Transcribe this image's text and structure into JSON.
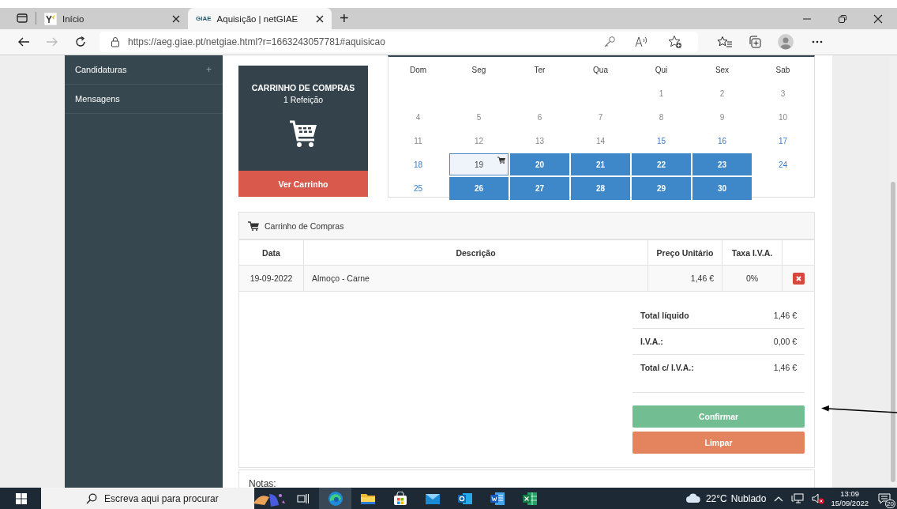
{
  "browser": {
    "tabs": [
      {
        "title": "Início",
        "selected": false,
        "favicon": {
          "kind": "image"
        }
      },
      {
        "title": "Aquisição | netGIAE",
        "selected": true,
        "favicon": {
          "kind": "text",
          "text": "GIAE"
        }
      }
    ],
    "new_tab": "+",
    "url": "https://aeg.giae.pt/netgiae.html?r=1663243057781#aquisicao"
  },
  "sidebar": {
    "items": [
      {
        "label": "Candidaturas",
        "expander": "+"
      },
      {
        "label": "Mensagens"
      }
    ]
  },
  "cart_card": {
    "title": "CARRINHO DE COMPRAS",
    "count": "1 Refeição",
    "button": "Ver Carrinho"
  },
  "calendar": {
    "weekdays": [
      "Dom",
      "Seg",
      "Ter",
      "Qua",
      "Qui",
      "Sex",
      "Sab"
    ],
    "weeks": [
      [
        {
          "kind": "empty"
        },
        {
          "kind": "empty"
        },
        {
          "kind": "empty"
        },
        {
          "kind": "empty"
        },
        {
          "day": "1",
          "kind": "muted"
        },
        {
          "day": "2",
          "kind": "muted"
        },
        {
          "day": "3",
          "kind": "muted"
        }
      ],
      [
        {
          "day": "4",
          "kind": "muted"
        },
        {
          "day": "5",
          "kind": "muted"
        },
        {
          "day": "6",
          "kind": "muted"
        },
        {
          "day": "7",
          "kind": "muted"
        },
        {
          "day": "8",
          "kind": "muted"
        },
        {
          "day": "9",
          "kind": "muted"
        },
        {
          "day": "10",
          "kind": "muted"
        }
      ],
      [
        {
          "day": "11",
          "kind": "muted"
        },
        {
          "day": "12",
          "kind": "muted"
        },
        {
          "day": "13",
          "kind": "muted"
        },
        {
          "day": "14",
          "kind": "muted"
        },
        {
          "day": "15",
          "kind": "link"
        },
        {
          "day": "16",
          "kind": "link"
        },
        {
          "day": "17",
          "kind": "link"
        }
      ],
      [
        {
          "day": "18",
          "kind": "link"
        },
        {
          "day": "19",
          "kind": "in-cart"
        },
        {
          "day": "20",
          "kind": "marked"
        },
        {
          "day": "21",
          "kind": "marked"
        },
        {
          "day": "22",
          "kind": "marked"
        },
        {
          "day": "23",
          "kind": "marked"
        },
        {
          "day": "24",
          "kind": "link"
        }
      ],
      [
        {
          "day": "25",
          "kind": "link"
        },
        {
          "day": "26",
          "kind": "marked"
        },
        {
          "day": "27",
          "kind": "marked"
        },
        {
          "day": "28",
          "kind": "marked"
        },
        {
          "day": "29",
          "kind": "marked"
        },
        {
          "day": "30",
          "kind": "marked"
        },
        {
          "kind": "empty"
        }
      ]
    ]
  },
  "cart_panel": {
    "title": "Carrinho de Compras",
    "columns": [
      "Data",
      "Descrição",
      "Preço Unitário",
      "Taxa I.V.A."
    ],
    "rows": [
      {
        "date": "19-09-2022",
        "description": "Almoço - Carne",
        "price": "1,46 €",
        "vat": "0%"
      }
    ],
    "totals": [
      {
        "label": "Total líquido",
        "value": "1,46 €"
      },
      {
        "label": "I.V.A.:",
        "value": "0,00 €"
      },
      {
        "label": "Total c/ I.V.A.:",
        "value": "1,46 €"
      }
    ],
    "confirm": "Confirmar",
    "clear": "Limpar",
    "notes_label": "Notas:"
  },
  "taskbar": {
    "search_placeholder": "Escreva aqui para procurar",
    "apps": [
      {
        "kind": "widgets",
        "active": false
      },
      {
        "kind": "taskview",
        "active": false
      },
      {
        "kind": "edge",
        "active": true
      },
      {
        "kind": "explorer",
        "active": false
      },
      {
        "kind": "store",
        "active": false
      },
      {
        "kind": "mail",
        "active": false
      },
      {
        "kind": "outlook",
        "active": false
      },
      {
        "kind": "word",
        "active": false
      },
      {
        "kind": "excel",
        "active": false
      }
    ],
    "temperature": "22°C",
    "weather": "Nublado",
    "time": "13:09",
    "date": "15/09/2022",
    "notifications": "20"
  }
}
